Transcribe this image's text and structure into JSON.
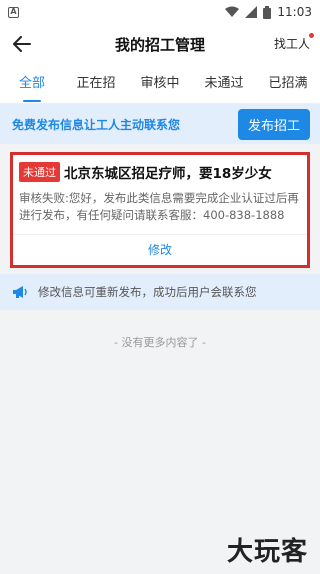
{
  "statusbar": {
    "time": "11:03"
  },
  "header": {
    "title": "我的招工管理",
    "right_link": "找工人"
  },
  "tabs": [
    {
      "label": "全部"
    },
    {
      "label": "正在招"
    },
    {
      "label": "审核中"
    },
    {
      "label": "未通过"
    },
    {
      "label": "已招满"
    }
  ],
  "active_tab": 0,
  "promo": {
    "text": "免费发布信息让工人主动联系您",
    "button": "发布招工"
  },
  "job": {
    "status_badge": "未通过",
    "title": "北京东城区招足疗师，要18岁少女",
    "reason": "审核失败:您好，发布此类信息需要完成企业认证过后再进行发布，有任何疑问请联系客服：400-838-1888",
    "edit_label": "修改"
  },
  "notice": {
    "text": "修改信息可重新发布，成功后用户会联系您"
  },
  "footer": {
    "no_more": "- 没有更多内容了 -"
  },
  "watermark": {
    "text": "大玩客"
  },
  "colors": {
    "accent": "#1e88e5",
    "danger": "#e53935",
    "highlight_border": "#d32f2f"
  },
  "icons": {
    "back": "arrow-left-icon",
    "notice": "megaphone-icon"
  }
}
